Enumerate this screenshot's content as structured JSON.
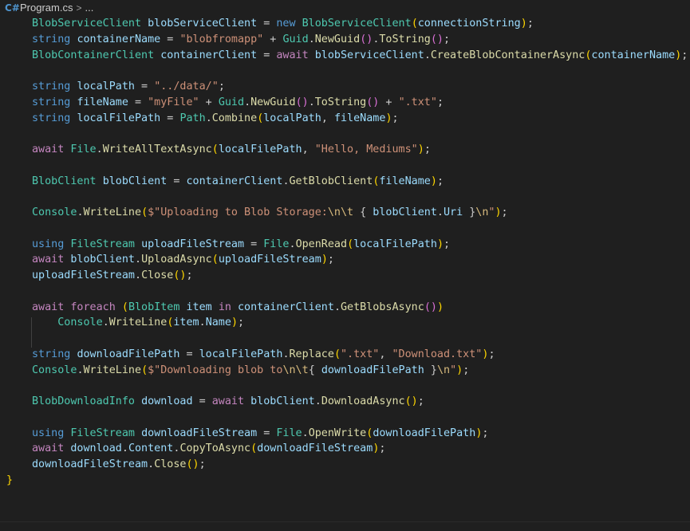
{
  "breadcrumb": {
    "icon": "csharp-file-icon",
    "file": "Program.cs",
    "separator": ">",
    "more": "..."
  },
  "editor": {
    "language": "csharp",
    "lines": [
      [
        [
          "t",
          "BlobServiceClient"
        ],
        [
          "p",
          " "
        ],
        [
          "v",
          "blobServiceClient"
        ],
        [
          "p",
          " = "
        ],
        [
          "k",
          "new"
        ],
        [
          "p",
          " "
        ],
        [
          "t",
          "BlobServiceClient"
        ],
        [
          "b",
          "("
        ],
        [
          "v",
          "connectionString"
        ],
        [
          "b",
          ")"
        ],
        [
          "p",
          ";"
        ]
      ],
      [
        [
          "k",
          "string"
        ],
        [
          "p",
          " "
        ],
        [
          "v",
          "containerName"
        ],
        [
          "p",
          " = "
        ],
        [
          "s",
          "\"blobfromapp\""
        ],
        [
          "p",
          " + "
        ],
        [
          "t",
          "Guid"
        ],
        [
          "p",
          "."
        ],
        [
          "m",
          "NewGuid"
        ],
        [
          "bp",
          "()"
        ],
        [
          "p",
          "."
        ],
        [
          "m",
          "ToString"
        ],
        [
          "bp",
          "()"
        ],
        [
          "p",
          ";"
        ]
      ],
      [
        [
          "t",
          "BlobContainerClient"
        ],
        [
          "p",
          " "
        ],
        [
          "v",
          "containerClient"
        ],
        [
          "p",
          " = "
        ],
        [
          "c",
          "await"
        ],
        [
          "p",
          " "
        ],
        [
          "v",
          "blobServiceClient"
        ],
        [
          "p",
          "."
        ],
        [
          "m",
          "CreateBlobContainerAsync"
        ],
        [
          "b",
          "("
        ],
        [
          "v",
          "containerName"
        ],
        [
          "b",
          ")"
        ],
        [
          "p",
          ";"
        ]
      ],
      [],
      [
        [
          "k",
          "string"
        ],
        [
          "p",
          " "
        ],
        [
          "v",
          "localPath"
        ],
        [
          "p",
          " = "
        ],
        [
          "s",
          "\"../data/\""
        ],
        [
          "p",
          ";"
        ]
      ],
      [
        [
          "k",
          "string"
        ],
        [
          "p",
          " "
        ],
        [
          "v",
          "fileName"
        ],
        [
          "p",
          " = "
        ],
        [
          "s",
          "\"myFile\""
        ],
        [
          "p",
          " + "
        ],
        [
          "t",
          "Guid"
        ],
        [
          "p",
          "."
        ],
        [
          "m",
          "NewGuid"
        ],
        [
          "bp",
          "()"
        ],
        [
          "p",
          "."
        ],
        [
          "m",
          "ToString"
        ],
        [
          "bp",
          "()"
        ],
        [
          "p",
          " + "
        ],
        [
          "s",
          "\".txt\""
        ],
        [
          "p",
          ";"
        ]
      ],
      [
        [
          "k",
          "string"
        ],
        [
          "p",
          " "
        ],
        [
          "v",
          "localFilePath"
        ],
        [
          "p",
          " = "
        ],
        [
          "t",
          "Path"
        ],
        [
          "p",
          "."
        ],
        [
          "m",
          "Combine"
        ],
        [
          "b",
          "("
        ],
        [
          "v",
          "localPath"
        ],
        [
          "p",
          ", "
        ],
        [
          "v",
          "fileName"
        ],
        [
          "b",
          ")"
        ],
        [
          "p",
          ";"
        ]
      ],
      [],
      [
        [
          "c",
          "await"
        ],
        [
          "p",
          " "
        ],
        [
          "t",
          "File"
        ],
        [
          "p",
          "."
        ],
        [
          "m",
          "WriteAllTextAsync"
        ],
        [
          "b",
          "("
        ],
        [
          "v",
          "localFilePath"
        ],
        [
          "p",
          ", "
        ],
        [
          "s",
          "\"Hello, Mediums\""
        ],
        [
          "b",
          ")"
        ],
        [
          "p",
          ";"
        ]
      ],
      [],
      [
        [
          "t",
          "BlobClient"
        ],
        [
          "p",
          " "
        ],
        [
          "v",
          "blobClient"
        ],
        [
          "p",
          " = "
        ],
        [
          "v",
          "containerClient"
        ],
        [
          "p",
          "."
        ],
        [
          "m",
          "GetBlobClient"
        ],
        [
          "b",
          "("
        ],
        [
          "v",
          "fileName"
        ],
        [
          "b",
          ")"
        ],
        [
          "p",
          ";"
        ]
      ],
      [],
      [
        [
          "t",
          "Console"
        ],
        [
          "p",
          "."
        ],
        [
          "m",
          "WriteLine"
        ],
        [
          "b",
          "("
        ],
        [
          "s",
          "$\"Uploading to Blob Storage:"
        ],
        [
          "e",
          "\\n\\t"
        ],
        [
          "s",
          " "
        ],
        [
          "p",
          "{ "
        ],
        [
          "v",
          "blobClient"
        ],
        [
          "p",
          "."
        ],
        [
          "v",
          "Uri"
        ],
        [
          "p",
          " }"
        ],
        [
          "e",
          "\\n"
        ],
        [
          "s",
          "\""
        ],
        [
          "b",
          ")"
        ],
        [
          "p",
          ";"
        ]
      ],
      [],
      [
        [
          "k",
          "using"
        ],
        [
          "p",
          " "
        ],
        [
          "t",
          "FileStream"
        ],
        [
          "p",
          " "
        ],
        [
          "v",
          "uploadFileStream"
        ],
        [
          "p",
          " = "
        ],
        [
          "t",
          "File"
        ],
        [
          "p",
          "."
        ],
        [
          "m",
          "OpenRead"
        ],
        [
          "b",
          "("
        ],
        [
          "v",
          "localFilePath"
        ],
        [
          "b",
          ")"
        ],
        [
          "p",
          ";"
        ]
      ],
      [
        [
          "c",
          "await"
        ],
        [
          "p",
          " "
        ],
        [
          "v",
          "blobClient"
        ],
        [
          "p",
          "."
        ],
        [
          "m",
          "UploadAsync"
        ],
        [
          "b",
          "("
        ],
        [
          "v",
          "uploadFileStream"
        ],
        [
          "b",
          ")"
        ],
        [
          "p",
          ";"
        ]
      ],
      [
        [
          "v",
          "uploadFileStream"
        ],
        [
          "p",
          "."
        ],
        [
          "m",
          "Close"
        ],
        [
          "b",
          "()"
        ],
        [
          "p",
          ";"
        ]
      ],
      [],
      [
        [
          "c",
          "await"
        ],
        [
          "p",
          " "
        ],
        [
          "c",
          "foreach"
        ],
        [
          "p",
          " "
        ],
        [
          "b",
          "("
        ],
        [
          "t",
          "BlobItem"
        ],
        [
          "p",
          " "
        ],
        [
          "v",
          "item"
        ],
        [
          "p",
          " "
        ],
        [
          "c",
          "in"
        ],
        [
          "p",
          " "
        ],
        [
          "v",
          "containerClient"
        ],
        [
          "p",
          "."
        ],
        [
          "m",
          "GetBlobsAsync"
        ],
        [
          "bp",
          "()"
        ],
        [
          "b",
          ")"
        ]
      ],
      [
        [
          "p",
          "    "
        ],
        [
          "t",
          "Console"
        ],
        [
          "p",
          "."
        ],
        [
          "m",
          "WriteLine"
        ],
        [
          "b",
          "("
        ],
        [
          "v",
          "item"
        ],
        [
          "p",
          "."
        ],
        [
          "v",
          "Name"
        ],
        [
          "b",
          ")"
        ],
        [
          "p",
          ";"
        ]
      ],
      [],
      [
        [
          "k",
          "string"
        ],
        [
          "p",
          " "
        ],
        [
          "v",
          "downloadFilePath"
        ],
        [
          "p",
          " = "
        ],
        [
          "v",
          "localFilePath"
        ],
        [
          "p",
          "."
        ],
        [
          "m",
          "Replace"
        ],
        [
          "b",
          "("
        ],
        [
          "s",
          "\".txt\""
        ],
        [
          "p",
          ", "
        ],
        [
          "s",
          "\"Download.txt\""
        ],
        [
          "b",
          ")"
        ],
        [
          "p",
          ";"
        ]
      ],
      [
        [
          "t",
          "Console"
        ],
        [
          "p",
          "."
        ],
        [
          "m",
          "WriteLine"
        ],
        [
          "b",
          "("
        ],
        [
          "s",
          "$\"Downloading blob to"
        ],
        [
          "e",
          "\\n\\t"
        ],
        [
          "p",
          "{ "
        ],
        [
          "v",
          "downloadFilePath"
        ],
        [
          "p",
          " }"
        ],
        [
          "e",
          "\\n"
        ],
        [
          "s",
          "\""
        ],
        [
          "b",
          ")"
        ],
        [
          "p",
          ";"
        ]
      ],
      [],
      [
        [
          "t",
          "BlobDownloadInfo"
        ],
        [
          "p",
          " "
        ],
        [
          "v",
          "download"
        ],
        [
          "p",
          " = "
        ],
        [
          "c",
          "await"
        ],
        [
          "p",
          " "
        ],
        [
          "v",
          "blobClient"
        ],
        [
          "p",
          "."
        ],
        [
          "m",
          "DownloadAsync"
        ],
        [
          "b",
          "()"
        ],
        [
          "p",
          ";"
        ]
      ],
      [],
      [
        [
          "k",
          "using"
        ],
        [
          "p",
          " "
        ],
        [
          "t",
          "FileStream"
        ],
        [
          "p",
          " "
        ],
        [
          "v",
          "downloadFileStream"
        ],
        [
          "p",
          " = "
        ],
        [
          "t",
          "File"
        ],
        [
          "p",
          "."
        ],
        [
          "m",
          "OpenWrite"
        ],
        [
          "b",
          "("
        ],
        [
          "v",
          "downloadFilePath"
        ],
        [
          "b",
          ")"
        ],
        [
          "p",
          ";"
        ]
      ],
      [
        [
          "c",
          "await"
        ],
        [
          "p",
          " "
        ],
        [
          "v",
          "download"
        ],
        [
          "p",
          "."
        ],
        [
          "v",
          "Content"
        ],
        [
          "p",
          "."
        ],
        [
          "m",
          "CopyToAsync"
        ],
        [
          "b",
          "("
        ],
        [
          "v",
          "downloadFileStream"
        ],
        [
          "b",
          ")"
        ],
        [
          "p",
          ";"
        ]
      ],
      [
        [
          "v",
          "downloadFileStream"
        ],
        [
          "p",
          "."
        ],
        [
          "m",
          "Close"
        ],
        [
          "b",
          "()"
        ],
        [
          "p",
          ";"
        ]
      ],
      [
        [
          "b",
          "}"
        ]
      ]
    ]
  }
}
